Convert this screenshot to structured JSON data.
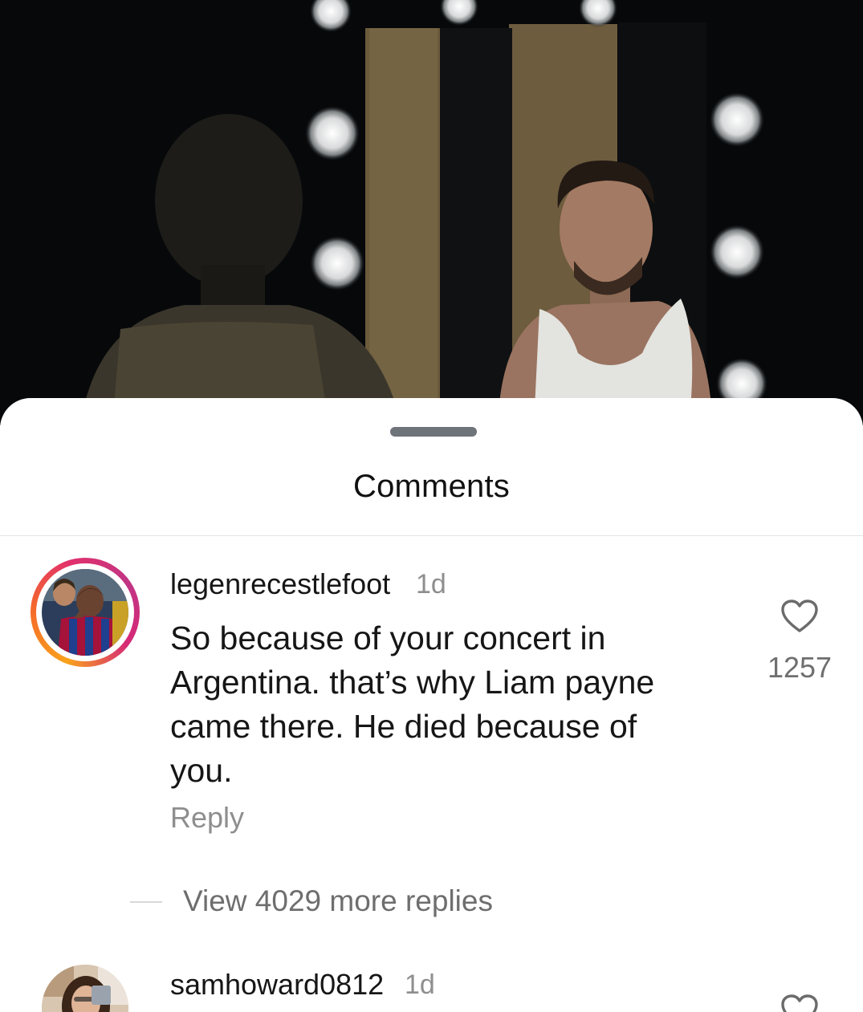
{
  "sheet": {
    "title": "Comments"
  },
  "comments": [
    {
      "username": "legenrecestlefoot",
      "time": "1d",
      "text": "So because of your concert in Argentina. that’s why Liam payne came there. He died because of you.",
      "reply_label": "Reply",
      "likes": "1257",
      "view_replies": "View 4029 more replies",
      "avatar_icon": "avatar-story-ring-icon"
    },
    {
      "username": "samhoward0812",
      "time": "1d",
      "avatar_icon": "avatar-icon"
    }
  ],
  "icons": {
    "like": "heart-outline-icon",
    "grabber": "sheet-grabber"
  },
  "colors": {
    "story_ring": [
      "#f9a21b",
      "#e1306c",
      "#c13584"
    ],
    "secondary_text": "#8e8e8e",
    "primary_text": "#161616"
  }
}
